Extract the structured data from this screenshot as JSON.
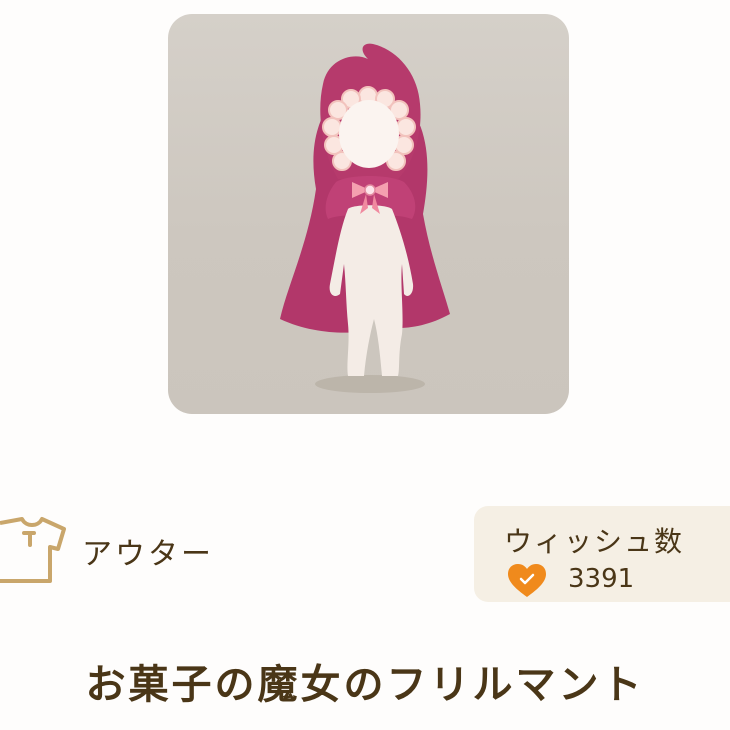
{
  "item": {
    "image_icon": "hooded-cape-mannequin-icon",
    "category_icon": "shirt-icon",
    "category": "アウター",
    "name": "お菓子の魔女のフリルマント"
  },
  "wish": {
    "label": "ウィッシュ数",
    "icon": "heart-check-icon",
    "count": "3391"
  },
  "colors": {
    "text": "#4a3617",
    "accent_gold": "#c9a66b",
    "heart": "#f08a1c",
    "wish_bg": "#f5efe4",
    "card_bg": "#d0cac2",
    "cape": "#b63a6c"
  }
}
